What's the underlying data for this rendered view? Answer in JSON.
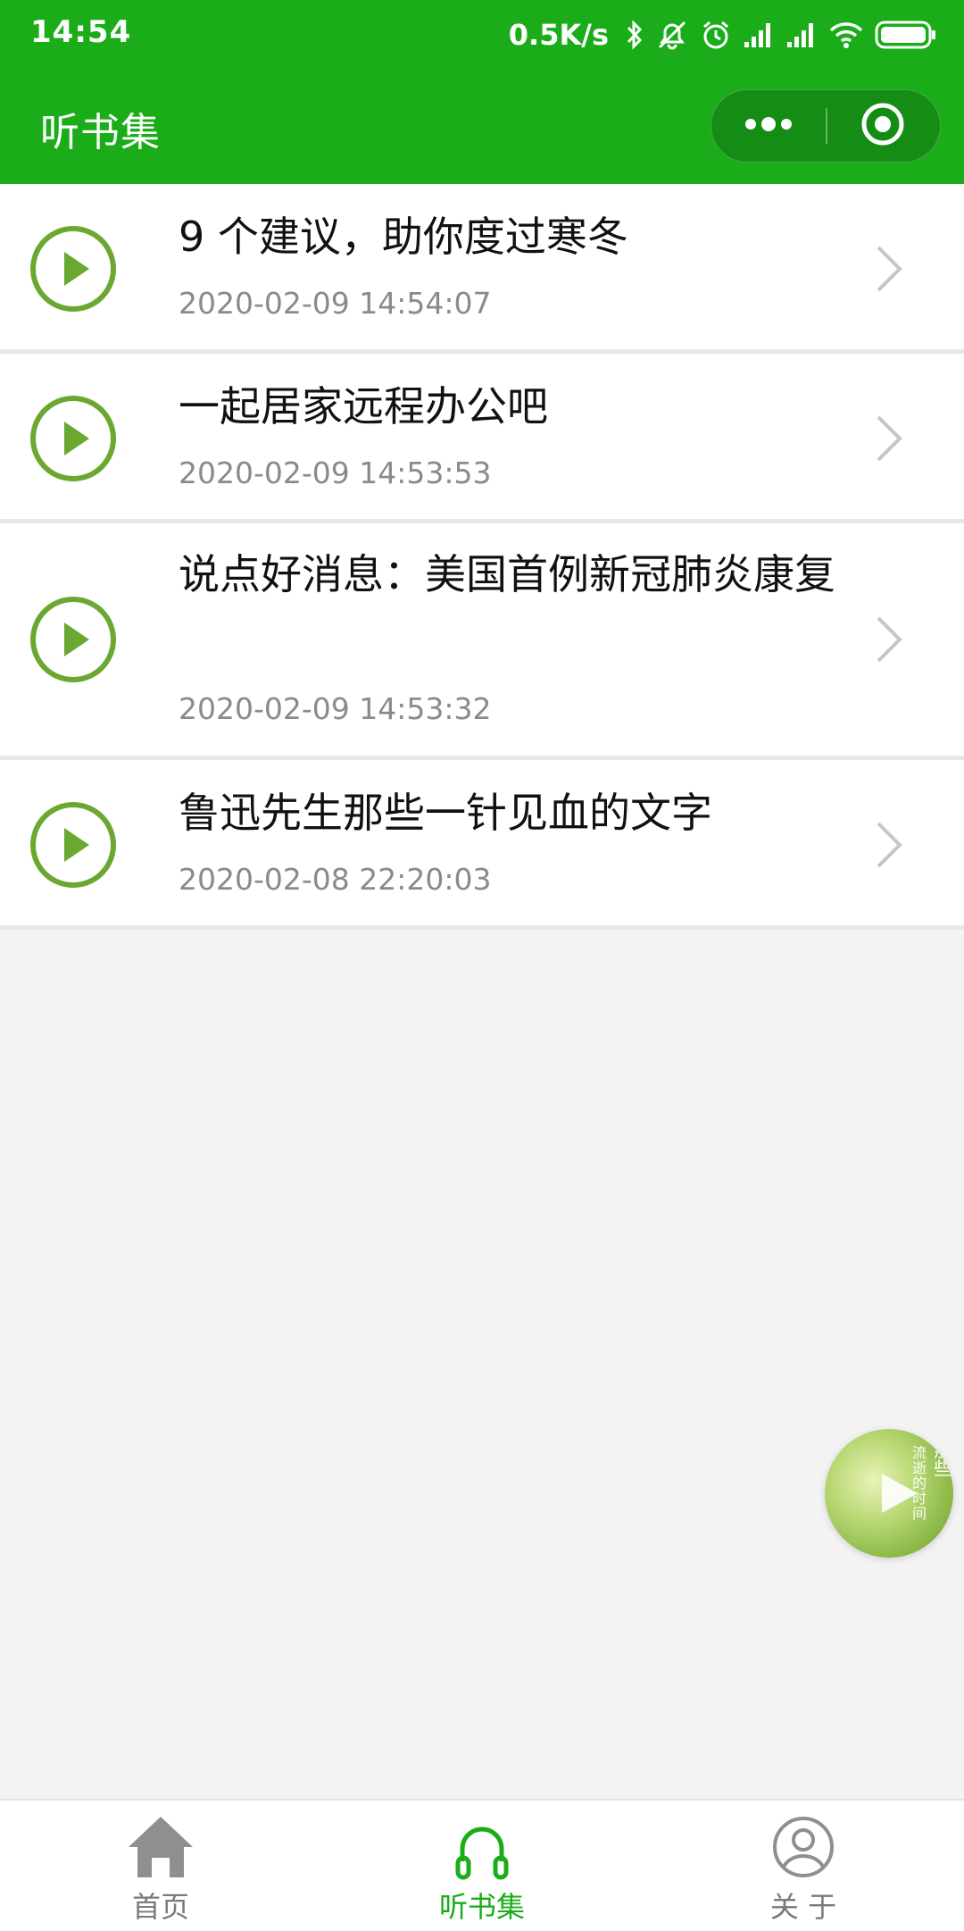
{
  "status_bar": {
    "time": "14:54",
    "net_speed": "0.5K/s",
    "icons": [
      "bluetooth-icon",
      "mute-icon",
      "alarm-icon",
      "signal-icon",
      "signal-icon",
      "wifi-icon",
      "battery-icon"
    ]
  },
  "nav": {
    "title": "听书集",
    "capsule_more_icon": "more-dots-icon",
    "capsule_close_icon": "close-target-icon"
  },
  "colors": {
    "brand_green": "#1aad19",
    "play_icon_green": "#6aa832",
    "text_primary": "#111111",
    "text_secondary": "#8a8a8a"
  },
  "items": [
    {
      "title": "9 个建议，助你度过寒冬",
      "date": "2020-02-09 14:54:07"
    },
    {
      "title": "一起居家远程办公吧",
      "date": "2020-02-09 14:53:53"
    },
    {
      "title": "说点好消息：美国首例新冠肺炎康复",
      "date": "2020-02-09 14:53:32"
    },
    {
      "title": "鲁迅先生那些一针见血的文字",
      "date": "2020-02-08 22:20:03"
    }
  ],
  "floating_player": {
    "cover_text_1": "流逝的时间",
    "cover_text_2": "那些",
    "icon": "play-icon"
  },
  "tabbar": {
    "tabs": [
      {
        "label": "首页",
        "icon": "home-icon",
        "active": false
      },
      {
        "label": "听书集",
        "icon": "headphones-icon",
        "active": true
      },
      {
        "label": "关 于",
        "icon": "user-icon",
        "active": false
      }
    ]
  }
}
